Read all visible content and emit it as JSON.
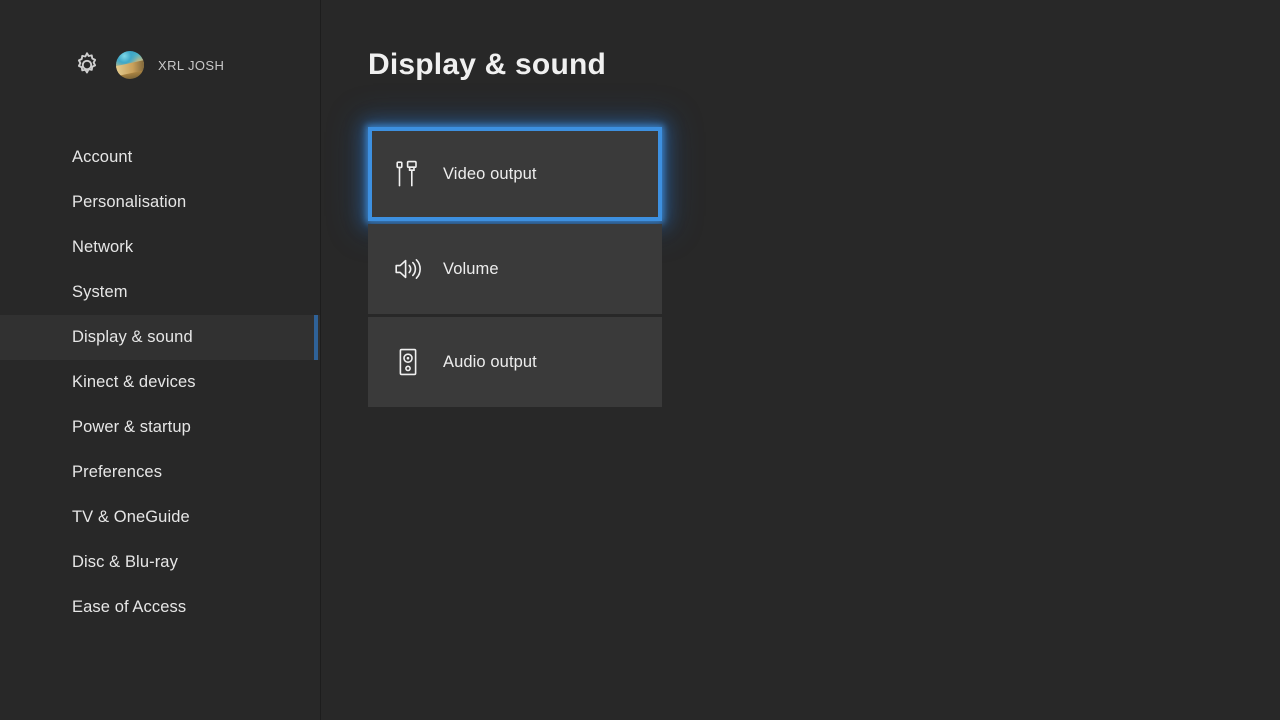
{
  "account": {
    "gear_icon": "gear-icon",
    "avatar_icon": "user-avatar",
    "gamertag": "XRL JOSH"
  },
  "sidebar": {
    "items": [
      {
        "label": "Account",
        "selected": false
      },
      {
        "label": "Personalisation",
        "selected": false
      },
      {
        "label": "Network",
        "selected": false
      },
      {
        "label": "System",
        "selected": false
      },
      {
        "label": "Display & sound",
        "selected": true
      },
      {
        "label": "Kinect & devices",
        "selected": false
      },
      {
        "label": "Power & startup",
        "selected": false
      },
      {
        "label": "Preferences",
        "selected": false
      },
      {
        "label": "TV & OneGuide",
        "selected": false
      },
      {
        "label": "Disc & Blu-ray",
        "selected": false
      },
      {
        "label": "Ease of Access",
        "selected": false
      }
    ]
  },
  "main": {
    "title": "Display & sound",
    "tiles": [
      {
        "label": "Video output",
        "icon": "video-cable-icon",
        "selected": true
      },
      {
        "label": "Volume",
        "icon": "speaker-volume-icon",
        "selected": false
      },
      {
        "label": "Audio output",
        "icon": "speaker-box-icon",
        "selected": false
      }
    ]
  },
  "colors": {
    "background": "#282828",
    "tile": "#3a3a3a",
    "selection_border": "#3d90e0",
    "nav_indicator": "#2f6298",
    "nav_selected_row": "#313131",
    "text": "#ededed"
  }
}
